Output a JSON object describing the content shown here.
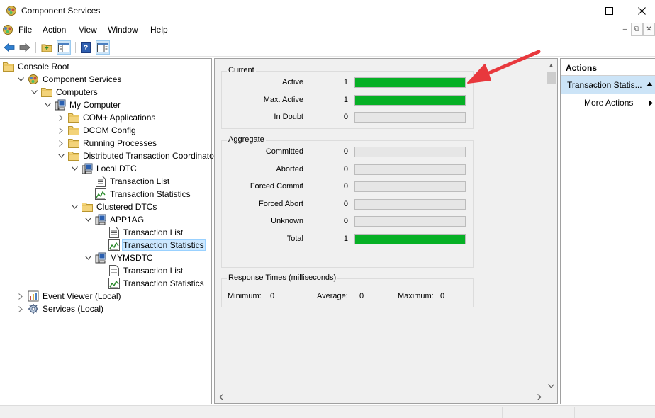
{
  "window": {
    "title": "Component Services"
  },
  "menu": [
    "File",
    "Action",
    "View",
    "Window",
    "Help"
  ],
  "tree": [
    {
      "label": "Console Root",
      "icon": "folder-icon",
      "expander": "none"
    },
    {
      "label": "Component Services",
      "icon": "component-services-icon",
      "expander": "open"
    },
    {
      "label": "Computers",
      "icon": "folder-icon",
      "expander": "open"
    },
    {
      "label": "My Computer",
      "icon": "computer-icon",
      "expander": "open"
    },
    {
      "label": "COM+ Applications",
      "icon": "folder-icon",
      "expander": "closed"
    },
    {
      "label": "DCOM Config",
      "icon": "folder-icon",
      "expander": "closed"
    },
    {
      "label": "Running Processes",
      "icon": "folder-icon",
      "expander": "closed"
    },
    {
      "label": "Distributed Transaction Coordinator",
      "icon": "folder-icon",
      "expander": "open"
    },
    {
      "label": "Local DTC",
      "icon": "computer-icon",
      "expander": "open"
    },
    {
      "label": "Transaction List",
      "icon": "list-icon",
      "expander": "none"
    },
    {
      "label": "Transaction Statistics",
      "icon": "statistics-icon",
      "expander": "none"
    },
    {
      "label": "Clustered DTCs",
      "icon": "folder-icon",
      "expander": "open"
    },
    {
      "label": "APP1AG",
      "icon": "computer-icon",
      "expander": "open"
    },
    {
      "label": "Transaction List",
      "icon": "list-icon",
      "expander": "none"
    },
    {
      "label": "Transaction Statistics",
      "icon": "statistics-icon",
      "expander": "none",
      "selected": true
    },
    {
      "label": "MYMSDTC",
      "icon": "computer-icon",
      "expander": "open"
    },
    {
      "label": "Transaction List",
      "icon": "list-icon",
      "expander": "none"
    },
    {
      "label": "Transaction Statistics",
      "icon": "statistics-icon",
      "expander": "none"
    },
    {
      "label": "Event Viewer (Local)",
      "icon": "event-viewer-icon",
      "expander": "closed"
    },
    {
      "label": "Services (Local)",
      "icon": "services-icon",
      "expander": "closed"
    }
  ],
  "stats": {
    "current": {
      "title": "Current",
      "rows": [
        {
          "label": "Active",
          "value": "1",
          "fill": 1.0
        },
        {
          "label": "Max. Active",
          "value": "1",
          "fill": 1.0
        },
        {
          "label": "In Doubt",
          "value": "0",
          "fill": 0.0
        }
      ]
    },
    "aggregate": {
      "title": "Aggregate",
      "rows": [
        {
          "label": "Committed",
          "value": "0",
          "fill": 0.0
        },
        {
          "label": "Aborted",
          "value": "0",
          "fill": 0.0
        },
        {
          "label": "Forced Commit",
          "value": "0",
          "fill": 0.0
        },
        {
          "label": "Forced Abort",
          "value": "0",
          "fill": 0.0
        },
        {
          "label": "Unknown",
          "value": "0",
          "fill": 0.0
        },
        {
          "label": "Total",
          "value": "1",
          "fill": 1.0
        }
      ]
    },
    "response": {
      "title": "Response Times (milliseconds)",
      "minimum_label": "Minimum:",
      "minimum_value": "0",
      "average_label": "Average:",
      "average_value": "0",
      "maximum_label": "Maximum:",
      "maximum_value": "0"
    }
  },
  "actions": {
    "header": "Actions",
    "section": "Transaction Statis...",
    "more_actions": "More Actions"
  },
  "colors": {
    "bar_fill": "#06b025",
    "selection": "#cce8ff",
    "arrow": "#e8383d"
  }
}
